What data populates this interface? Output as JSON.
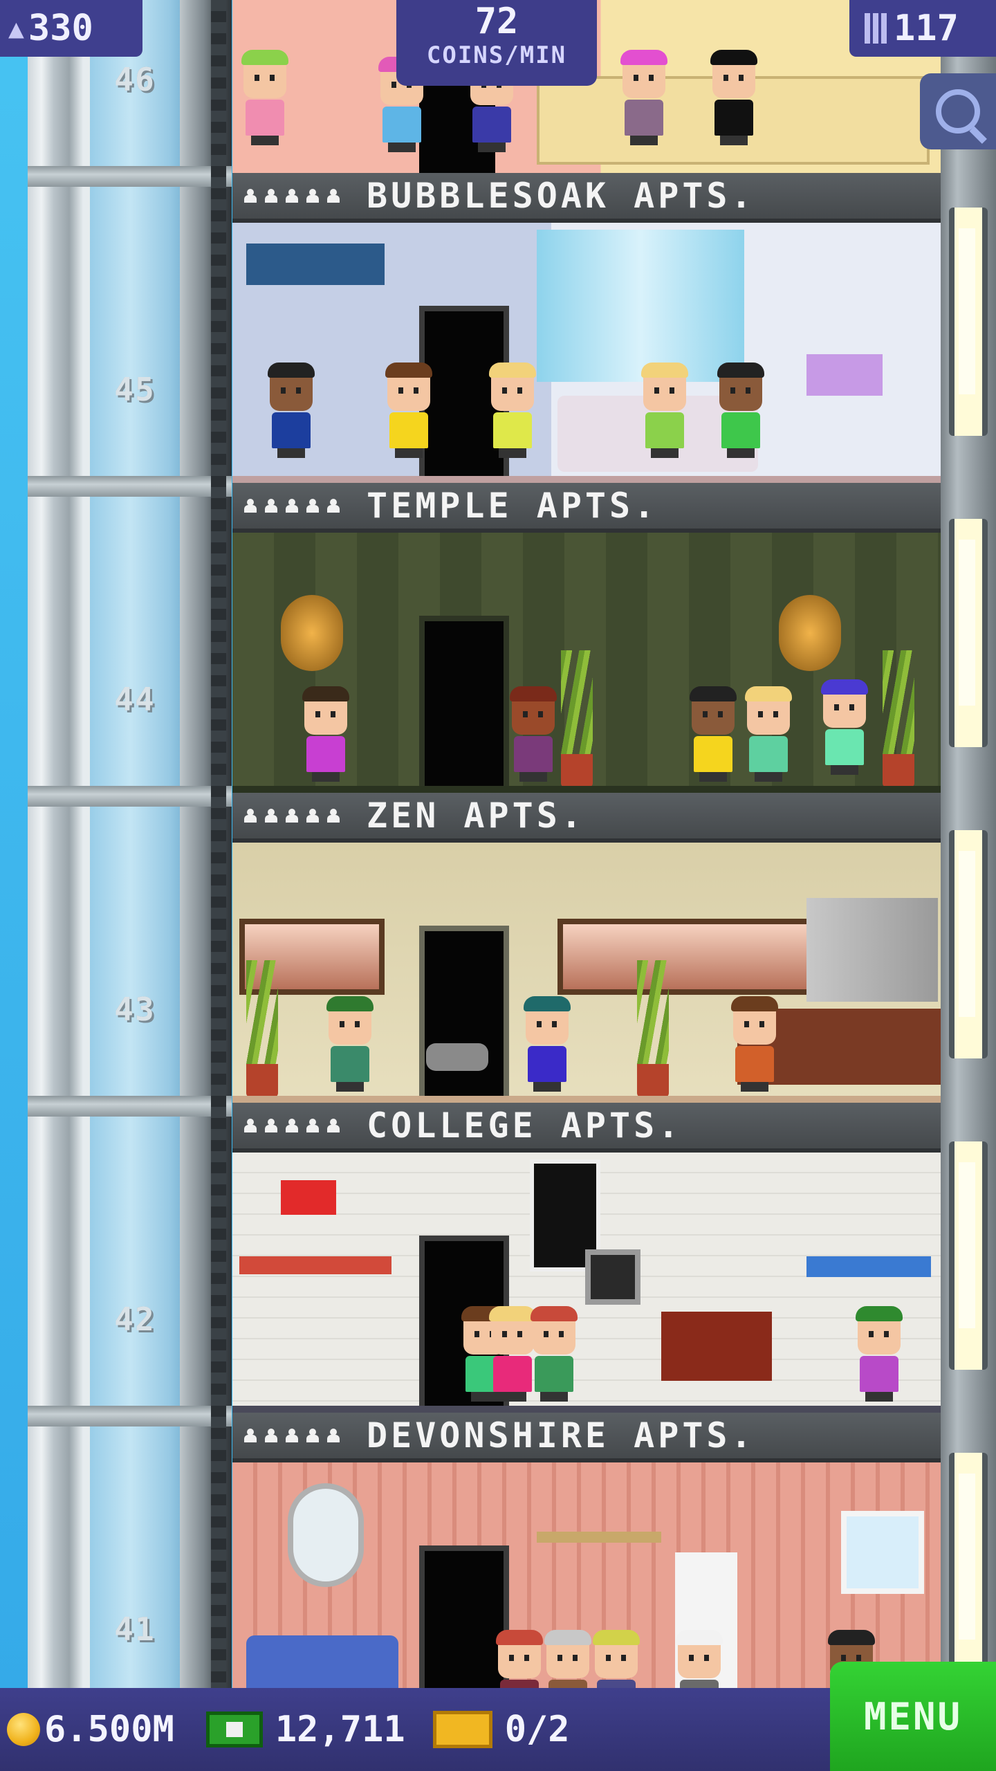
{
  "hud": {
    "population": "330",
    "coins_per_min_value": "72",
    "coins_per_min_label": "COINS/MIN",
    "floors": "117",
    "population_icon": "person-icon",
    "floors_icon": "building-icon",
    "search_icon": "magnifier-icon"
  },
  "floors": [
    {
      "number": "46",
      "name": "BUBBLESOAK APTS.",
      "stars": 5
    },
    {
      "number": "45",
      "name": "TEMPLE APTS.",
      "stars": 5
    },
    {
      "number": "44",
      "name": "ZEN APTS.",
      "stars": 5
    },
    {
      "number": "43",
      "name": "COLLEGE APTS.",
      "stars": 5
    },
    {
      "number": "42",
      "name": "DEVONSHIRE APTS.",
      "stars": 5
    },
    {
      "number": "41",
      "name": "",
      "stars": 0
    }
  ],
  "bottom": {
    "coins": "6.500M",
    "bux": "12,711",
    "tickets": "0/2",
    "menu_label": "MENU"
  },
  "colors": {
    "hud_bg": "#3f3f8e",
    "menu_green": "#2fc12f",
    "label_bar": "#505458",
    "sky": "#3ab8ef"
  }
}
